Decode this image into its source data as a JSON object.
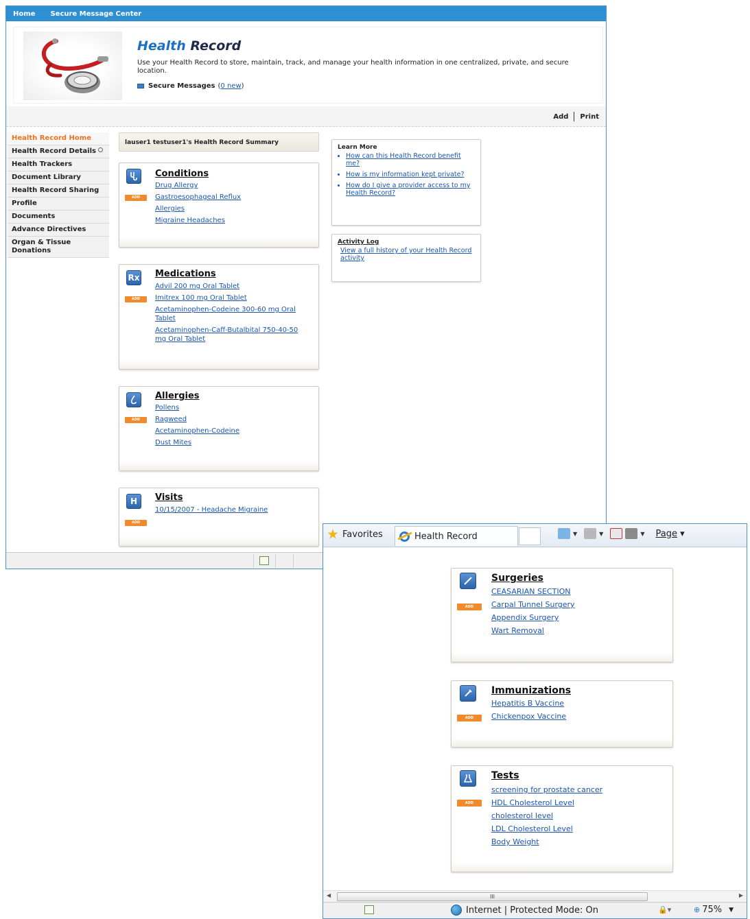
{
  "topnav": {
    "home": "Home",
    "secure_center": "Secure Message Center"
  },
  "banner": {
    "title_part1": "Health",
    "title_part2": "Record",
    "description": "Use your Health Record to store, maintain, track, and manage your health information in one centralized, private, and secure location.",
    "secure_label": "Secure Messages",
    "secure_count": "0 new",
    "secure_paren_open": "(",
    "secure_paren_close": ")"
  },
  "toolbar": {
    "add": "Add",
    "print": "Print"
  },
  "sidebar": {
    "items": [
      {
        "label": "Health Record Home"
      },
      {
        "label": "Health Record Details"
      },
      {
        "label": "Health Trackers"
      },
      {
        "label": "Document Library"
      },
      {
        "label": "Health Record Sharing"
      },
      {
        "label": "Profile"
      },
      {
        "label": "Documents"
      },
      {
        "label": "Advance Directives"
      },
      {
        "label": "Organ & Tissue Donations"
      }
    ]
  },
  "summary": {
    "title": "lauser1 testuser1's Health Record Summary"
  },
  "add_label": "ADD",
  "cards": {
    "conditions": {
      "title": "Conditions",
      "icon": "stethoscope-icon",
      "items": [
        "Drug Allergy",
        "Gastroesophageal Reflux",
        "Allergies",
        "Migraine Headaches"
      ]
    },
    "medications": {
      "title": "Medications",
      "icon": "rx-icon",
      "icon_text": "Rx",
      "items": [
        "Advil 200 mg Oral Tablet",
        "Imitrex 100 mg Oral Tablet",
        "Acetaminophen-Codeine 300-60 mg Oral Tablet",
        "Acetaminophen-Caff-Butalbital 750-40-50 mg Oral Tablet"
      ]
    },
    "allergies": {
      "title": "Allergies",
      "icon": "nose-icon",
      "items": [
        "Pollens",
        "Ragweed",
        "Acetaminophen-Codeine",
        "Dust Mites"
      ]
    },
    "visits": {
      "title": "Visits",
      "icon": "hospital-icon",
      "icon_text": "H",
      "items": [
        "10/15/2007 - Headache Migraine"
      ]
    },
    "surgeries": {
      "title": "Surgeries",
      "icon": "scalpel-icon",
      "items": [
        "CEASARIAN SECTION",
        "Carpal Tunnel Surgery",
        "Appendix Surgery",
        "Wart Removal"
      ]
    },
    "immunizations": {
      "title": "Immunizations",
      "icon": "syringe-icon",
      "items": [
        "Hepatitis B Vaccine",
        "Chickenpox Vaccine"
      ]
    },
    "tests": {
      "title": "Tests",
      "icon": "flask-icon",
      "items": [
        "screening for prostate cancer",
        "HDL Cholesterol Level",
        "cholesterol level",
        "LDL Cholesterol Level",
        "Body Weight"
      ]
    }
  },
  "learn_more": {
    "title": "Learn More",
    "items": [
      "How can this Health Record benefit me?",
      "How is my information kept private?",
      "How do I give a provider access to my Health Record?"
    ]
  },
  "activity_log": {
    "title": "Activity Log",
    "link": "View a full history of your Health Record activity"
  },
  "browser": {
    "favorites": "Favorites",
    "tab_title": "Health Record",
    "page_menu": "Page",
    "hscroll_grip": "III",
    "status_zone": "Internet | Protected Mode: On",
    "zoom": "75%"
  },
  "colors": {
    "nav_blue": "#2f8fd3",
    "active_orange": "#e8741f",
    "add_orange": "#f08a2b",
    "link_blue": "#1a55b0"
  }
}
